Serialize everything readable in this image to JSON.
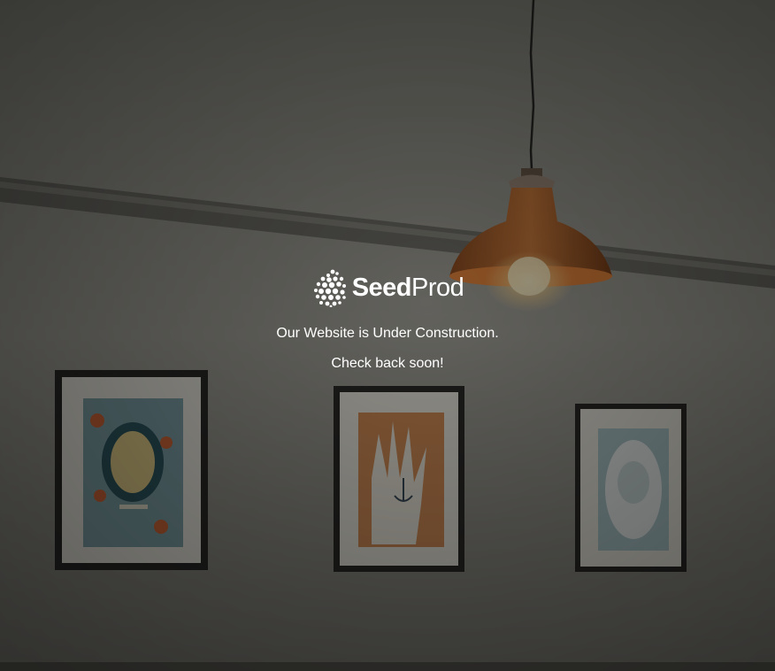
{
  "logo": {
    "icon": "seedprod-seed-icon",
    "brand_bold": "Seed",
    "brand_light": "Prod"
  },
  "message": {
    "headline": "Our Website is Under Construction.",
    "subline": "Check back soon!"
  },
  "colors": {
    "text": "#ffffff",
    "wall": "#6e6d66",
    "lamp": "#b8652e"
  }
}
